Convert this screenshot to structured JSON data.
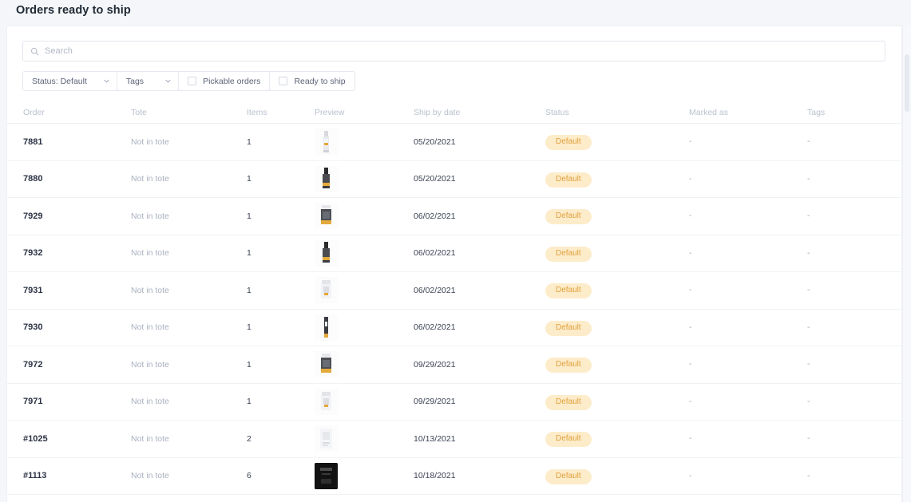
{
  "page": {
    "title": "Orders ready to ship",
    "background_color": "#f4f6f9"
  },
  "search": {
    "placeholder": "Search",
    "value": "",
    "icon": "search-icon"
  },
  "filters": [
    {
      "type": "select",
      "label": "Status: Default",
      "icon": "chevron-down-icon"
    },
    {
      "type": "select",
      "label": "Tags",
      "icon": "chevron-down-icon"
    },
    {
      "type": "checkbox",
      "label": "Pickable orders",
      "checked": false
    },
    {
      "type": "checkbox",
      "label": "Ready to ship",
      "checked": false
    }
  ],
  "table": {
    "columns": [
      "Order",
      "Tote",
      "Items",
      "Preview",
      "Ship by date",
      "Status",
      "Marked as",
      "Tags"
    ],
    "empty_value": "-",
    "status_badge_colors": {
      "background": "#fdecca",
      "text": "#e0a03c"
    },
    "rows": [
      {
        "order": "7881",
        "tote": "Not in tote",
        "items": "1",
        "preview": "dropper-bottle-clear-thumbnail",
        "ship_by_date": "05/20/2021",
        "status": "Default",
        "marked_as": "-",
        "tags": "-"
      },
      {
        "order": "7880",
        "tote": "Not in tote",
        "items": "1",
        "preview": "dropper-bottle-dark-thumbnail",
        "ship_by_date": "05/20/2021",
        "status": "Default",
        "marked_as": "-",
        "tags": "-"
      },
      {
        "order": "7929",
        "tote": "Not in tote",
        "items": "1",
        "preview": "jar-dark-thumbnail",
        "ship_by_date": "06/02/2021",
        "status": "Default",
        "marked_as": "-",
        "tags": "-"
      },
      {
        "order": "7932",
        "tote": "Not in tote",
        "items": "1",
        "preview": "dropper-bottle-dark-thumbnail",
        "ship_by_date": "06/02/2021",
        "status": "Default",
        "marked_as": "-",
        "tags": "-"
      },
      {
        "order": "7931",
        "tote": "Not in tote",
        "items": "1",
        "preview": "jar-light-thumbnail",
        "ship_by_date": "06/02/2021",
        "status": "Default",
        "marked_as": "-",
        "tags": "-"
      },
      {
        "order": "7930",
        "tote": "Not in tote",
        "items": "1",
        "preview": "tube-dark-thumbnail",
        "ship_by_date": "06/02/2021",
        "status": "Default",
        "marked_as": "-",
        "tags": "-"
      },
      {
        "order": "7972",
        "tote": "Not in tote",
        "items": "1",
        "preview": "jar-dark-thumbnail",
        "ship_by_date": "09/29/2021",
        "status": "Default",
        "marked_as": "-",
        "tags": "-"
      },
      {
        "order": "7971",
        "tote": "Not in tote",
        "items": "1",
        "preview": "jar-light-thumbnail",
        "ship_by_date": "09/29/2021",
        "status": "Default",
        "marked_as": "-",
        "tags": "-"
      },
      {
        "order": "#1025",
        "tote": "Not in tote",
        "items": "2",
        "preview": "box-light-thumbnail",
        "ship_by_date": "10/13/2021",
        "status": "Default",
        "marked_as": "-",
        "tags": "-"
      },
      {
        "order": "#1113",
        "tote": "Not in tote",
        "items": "6",
        "preview": "product-black-thumbnail",
        "ship_by_date": "10/18/2021",
        "status": "Default",
        "marked_as": "-",
        "tags": "-"
      }
    ]
  }
}
